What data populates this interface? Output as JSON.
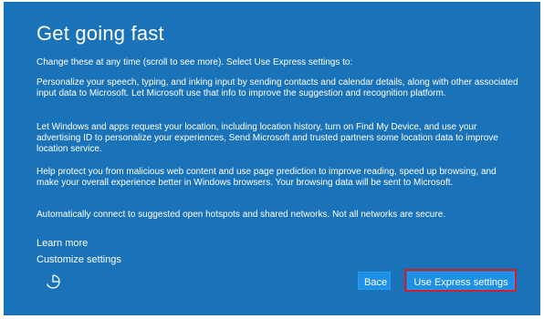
{
  "page": {
    "title": "Get going fast",
    "intro": "Change these at any time (scroll to see more). Select Use Express settings to:",
    "paragraphs": [
      "Personalize your speech, typing, and inking input by sending contacts and calendar details, along with other associated input data to Microsoft. Let Microsoft use that info to improve the suggestion and recognition platform.",
      "Let Windows and apps request your location, including location history, turn on Find My Device, and use your advertising ID to personalize your experiences, Send Microsoft and trusted partners some location data to improve location service.",
      "Help protect you from malicious web content and use page prediction to improve reading, speed up browsing, and make your overall experience better in Windows browsers. Your browsing data will be sent to Microsoft.",
      "Automatically connect to suggested open hotspots and shared networks. Not all networks are secure."
    ]
  },
  "links": {
    "learn_more": "Learn more",
    "customize": "Customize settings"
  },
  "buttons": {
    "back": "Bace",
    "express": "Use Express settings"
  },
  "icons": {
    "ease_of_access": "ease-of-access-icon"
  },
  "colors": {
    "background": "#1a73b8",
    "button": "#1e90e8",
    "highlight": "#d0202e"
  }
}
